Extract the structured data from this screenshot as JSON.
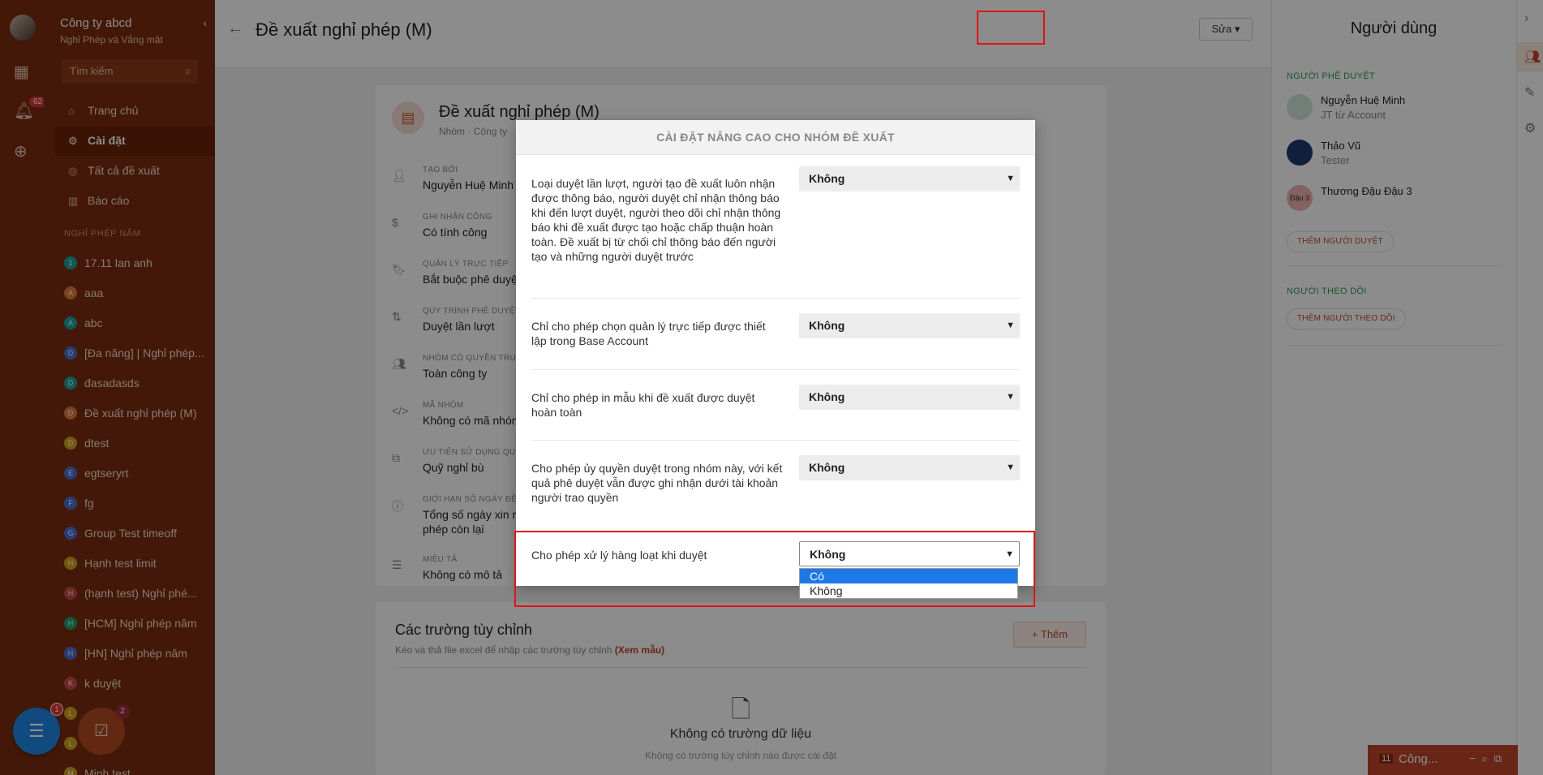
{
  "sidebar": {
    "company": "Công ty abcd",
    "module": "Nghỉ Phép và Vắng mặt",
    "notif_count": "62",
    "search_placeholder": "Tìm kiếm",
    "nav": [
      {
        "label": "Trang chủ",
        "icon": "home-icon",
        "active": false
      },
      {
        "label": "Cài đặt",
        "icon": "gear-icon",
        "active": true
      },
      {
        "label": "Tất cả đề xuất",
        "icon": "circle-icon",
        "active": false
      },
      {
        "label": "Báo cáo",
        "icon": "chart-icon",
        "active": false
      }
    ],
    "section_title": "NGHỈ PHÉP NĂM",
    "groups": [
      {
        "letter": "1",
        "label": "17.11 lan anh",
        "color": "#1ca3a3"
      },
      {
        "letter": "A",
        "label": "aaa",
        "color": "#e07a3a"
      },
      {
        "letter": "A",
        "label": "abc",
        "color": "#1ca3a3"
      },
      {
        "letter": "D",
        "label": "[Đa năng] | Nghỉ phép...",
        "color": "#4a6fd6"
      },
      {
        "letter": "D",
        "label": "đasadasds",
        "color": "#1ca3a3"
      },
      {
        "letter": "D",
        "label": "Đề xuất nghỉ phép (M)",
        "color": "#e07a3a"
      },
      {
        "letter": "D",
        "label": "dtest",
        "color": "#d6a21c"
      },
      {
        "letter": "E",
        "label": "egtseryrt",
        "color": "#4a6fd6"
      },
      {
        "letter": "F",
        "label": "fg",
        "color": "#4a6fd6"
      },
      {
        "letter": "G",
        "label": "Group Test timeoff",
        "color": "#4a6fd6"
      },
      {
        "letter": "H",
        "label": "Hạnh test limit",
        "color": "#d6a21c"
      },
      {
        "letter": "H",
        "label": "(hạnh test) Nghỉ phé...",
        "color": "#c84a4a"
      },
      {
        "letter": "H",
        "label": "[HCM] Nghỉ phép năm",
        "color": "#1ca36a"
      },
      {
        "letter": "H",
        "label": "[HN] Nghỉ phép năm",
        "color": "#4a6fd6"
      },
      {
        "letter": "K",
        "label": "k duyệt",
        "color": "#c84a4a"
      },
      {
        "letter": "L",
        "label": "",
        "color": "#d6a21c"
      },
      {
        "letter": "L",
        "label": "",
        "color": "#d6a21c"
      },
      {
        "letter": "M",
        "label": "Minh test",
        "color": "#d6a21c"
      }
    ],
    "chat_badge": "1",
    "task_badge": "2"
  },
  "header": {
    "title": "Đề xuất nghỉ phép (M)",
    "edit_label": "Sửa"
  },
  "card": {
    "title": "Đề xuất nghỉ phép (M)",
    "subtitle": "Nhóm · Công ty",
    "fields": [
      {
        "icon": "person-icon",
        "label": "TẠO BỞI",
        "value": "Nguyễn Huệ Minh"
      },
      {
        "icon": "dollar-icon",
        "label": "GHI NHẬN CÔNG",
        "value": "Có tính công"
      },
      {
        "icon": "bookmark-icon",
        "label": "QUẢN LÝ TRỰC TIẾP",
        "value": "Bắt buộc phê duyệt"
      },
      {
        "icon": "sort-icon",
        "label": "QUY TRÌNH PHÊ DUYỆT",
        "value": "Duyệt lần lượt"
      },
      {
        "icon": "group-icon",
        "label": "NHÓM CÓ QUYỀN TRUY",
        "value": "Toàn công ty"
      },
      {
        "icon": "code-icon",
        "label": "MÃ NHÓM",
        "value": "Không có mã nhóm"
      },
      {
        "icon": "copy-icon",
        "label": "ƯU TIÊN SỬ DỤNG QUỸ N",
        "value": "Quỹ nghỉ bù"
      },
      {
        "icon": "info-icon",
        "label": "GIỚI HẠN SỐ NGÀY ĐỀ X",
        "value": "Tổng số ngày xin nghỉ\nphép còn lại"
      },
      {
        "icon": "list-icon",
        "label": "MIÊU TẢ",
        "value": "Không có mô tả"
      }
    ]
  },
  "custom_fields": {
    "title": "Các trường tùy chỉnh",
    "subtitle": "Kéo và thả file excel để nhập các trường tùy chỉnh",
    "sample_link": "(Xem mẫu)",
    "add_label": "Thêm",
    "empty_title": "Không có trường dữ liệu",
    "empty_desc": "Không có trường tùy chỉnh nào được cài đặt"
  },
  "right_panel": {
    "title": "Người dùng",
    "approvers_title": "NGƯỜI PHÊ DUYỆT",
    "approvers": [
      {
        "name": "Nguyễn Huệ Minh",
        "role": "JT từ Account",
        "avatar": "",
        "color": "#cfe8dc"
      },
      {
        "name": "Thảo Vũ",
        "role": "Tester",
        "avatar": "",
        "color": "#1f3a6e"
      },
      {
        "name": "Thương Đậu Đậu 3",
        "role": "",
        "avatar": "Đậu 3",
        "color": "#f3b1b1"
      }
    ],
    "add_approver": "THÊM NGƯỜI DUYỆT",
    "followers_title": "NGƯỜI THEO DÕI",
    "add_follower": "THÊM NGƯỜI THEO DÕI"
  },
  "mini_chat": {
    "count": "11",
    "label": "Công..."
  },
  "modal": {
    "title": "CÀI ĐẶT NÂNG CAO CHO NHÓM ĐỀ XUẤT",
    "rows": [
      {
        "label": "Loại duyệt lần lượt, người tạo đề xuất luôn nhận được thông báo, người duyệt chỉ nhận thông báo khi đến lượt duyệt, người theo dõi chỉ nhận thông báo khi đề xuất được tạo hoặc chấp thuận hoàn toàn. Đề xuất bị từ chối chỉ thông báo đến người tạo và những người duyệt trước",
        "value": "Không"
      },
      {
        "label": "Chỉ cho phép chọn quản lý trực tiếp được thiết lập trong Base Account",
        "value": "Không"
      },
      {
        "label": "Chỉ cho phép in mẫu khi đề xuất được duyệt hoàn toàn",
        "value": "Không"
      },
      {
        "label": "Cho phép ủy quyền duyệt trong nhóm này, với kết quả phê duyệt vẫn được ghi nhận dưới tài khoản người trao quyền",
        "value": "Không"
      },
      {
        "label": "Cho phép xử lý hàng loạt khi duyệt",
        "value": "Không"
      }
    ],
    "dropdown_options": [
      "Có",
      "Không"
    ],
    "dropdown_highlighted": "Có"
  }
}
